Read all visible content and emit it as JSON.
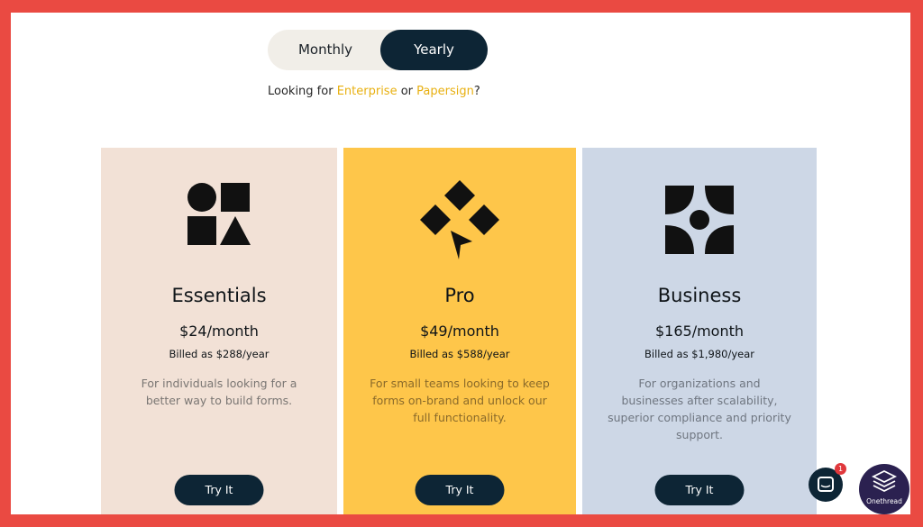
{
  "billing_toggle": {
    "monthly_label": "Monthly",
    "yearly_label": "Yearly",
    "selected": "Yearly"
  },
  "looking_for": {
    "prefix": "Looking for ",
    "enterprise": "Enterprise",
    "or": " or ",
    "papersign": "Papersign",
    "suffix": "?"
  },
  "plans": [
    {
      "name": "Essentials",
      "price": "$24/month",
      "billed": "Billed as $288/year",
      "description": "For individuals looking for a better way to build forms.",
      "cta": "Try It",
      "icon": "shapes-icon",
      "color": "#f2e1d6"
    },
    {
      "name": "Pro",
      "price": "$49/month",
      "billed": "Billed as $588/year",
      "description": "For small teams looking to keep forms on-brand and unlock our full functionality.",
      "cta": "Try It",
      "icon": "diamonds-cursor-icon",
      "color": "#fec64a"
    },
    {
      "name": "Business",
      "price": "$165/month",
      "billed": "Billed as $1,980/year",
      "description": "For organizations and businesses after scalability, superior compliance and priority support.",
      "cta": "Try It",
      "icon": "petals-icon",
      "color": "#cdd7e6"
    }
  ],
  "chat_widget": {
    "badge_count": "1",
    "icon": "chat-icon"
  },
  "watermark": {
    "label": "Onethread",
    "icon": "onethread-logo-icon"
  },
  "colors": {
    "border": "#ea4a42",
    "dark": "#0d2535",
    "link": "#e8b011"
  }
}
